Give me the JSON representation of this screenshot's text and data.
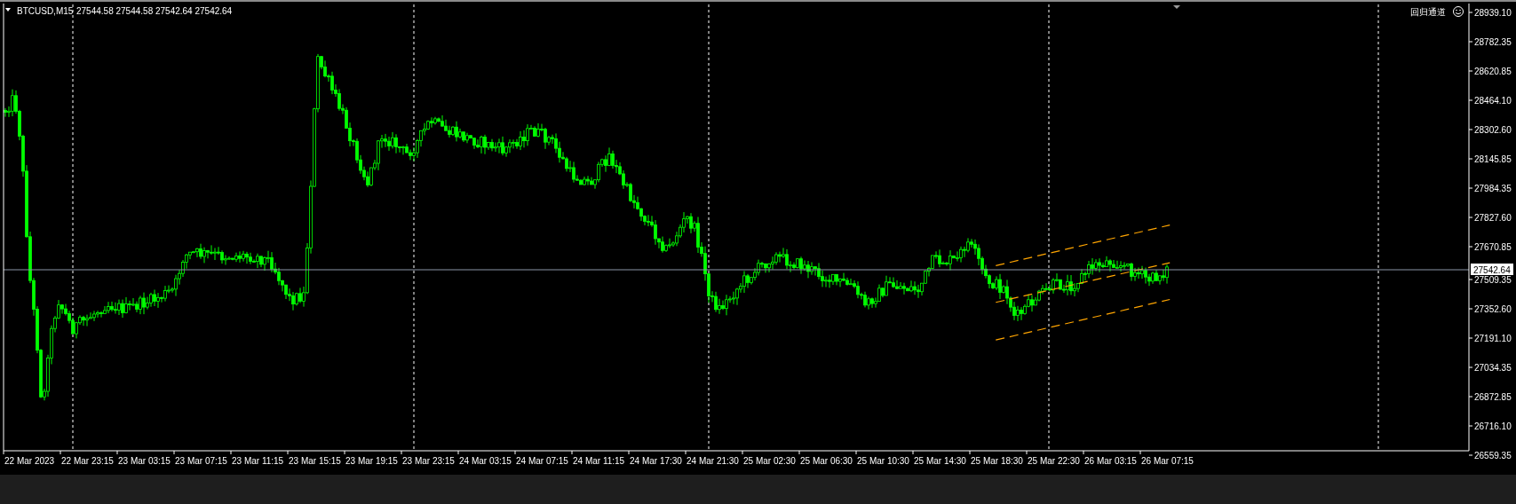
{
  "header": {
    "symbol": "BTCUSD,M15",
    "quote": "27544.58 27544.58 27542.64 27542.64"
  },
  "indicator": {
    "label": "回归通道"
  },
  "price_axis": [
    "28939.10",
    "28782.35",
    "28620.85",
    "28464.10",
    "28302.60",
    "28145.85",
    "27984.35",
    "27827.60",
    "27670.85",
    "27509.35",
    "27352.60",
    "27191.10",
    "27034.35",
    "26872.85",
    "26716.10",
    "26559.35"
  ],
  "current_price": "27542.64",
  "time_axis": [
    "22 Mar 2023",
    "22 Mar 23:15",
    "23 Mar 03:15",
    "23 Mar 07:15",
    "23 Mar 11:15",
    "23 Mar 15:15",
    "23 Mar 19:15",
    "23 Mar 23:15",
    "24 Mar 03:15",
    "24 Mar 07:15",
    "24 Mar 11:15",
    "24 Mar 17:30",
    "24 Mar 21:30",
    "25 Mar 02:30",
    "25 Mar 06:30",
    "25 Mar 10:30",
    "25 Mar 14:30",
    "25 Mar 18:30",
    "25 Mar 22:30",
    "26 Mar 03:15",
    "26 Mar 07:15"
  ]
}
